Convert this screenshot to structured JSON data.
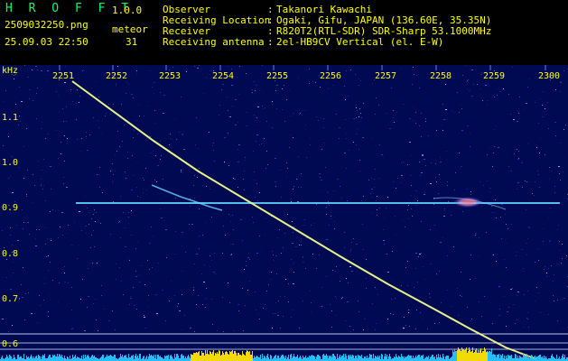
{
  "app": {
    "name": "H R O F F T",
    "version": "1.0.0"
  },
  "file": {
    "filename": "2509032250.png",
    "datetime": "25.09.03 22:50"
  },
  "meteor": {
    "label": "meteor",
    "count": "31"
  },
  "info": [
    {
      "key": "Observer",
      "sep": ":",
      "value": "Takanori Kawachi"
    },
    {
      "key": "Receiving Location",
      "sep": ":",
      "value": "Ogaki, Gifu, JAPAN (136.60E, 35.35N)"
    },
    {
      "key": "Receiver",
      "sep": ":",
      "value": "R820T2(RTL-SDR) SDR-Sharp 53.1000MHz"
    },
    {
      "key": "Receiving antenna",
      "sep": ":",
      "value": "2el-HB9CV Vertical (el. E-W)"
    }
  ],
  "axes": {
    "y_unit": "kHz",
    "y_ticks": [
      "1.1",
      "1.0",
      "0.9",
      "0.8",
      "0.7",
      "0.6"
    ],
    "x_ticks": [
      "2251",
      "2252",
      "2253",
      "2254",
      "2255",
      "2256",
      "2257",
      "2258",
      "2259",
      "2300"
    ]
  },
  "colors": {
    "background": "#000000",
    "spectrogram_base": "#000a52",
    "header_text": "#ffff00",
    "trace": "#f2ff8c",
    "horizontal_line": "#60d0ff",
    "bottom_band": "#27c8ff",
    "bottom_peak": "#ffe600"
  }
}
